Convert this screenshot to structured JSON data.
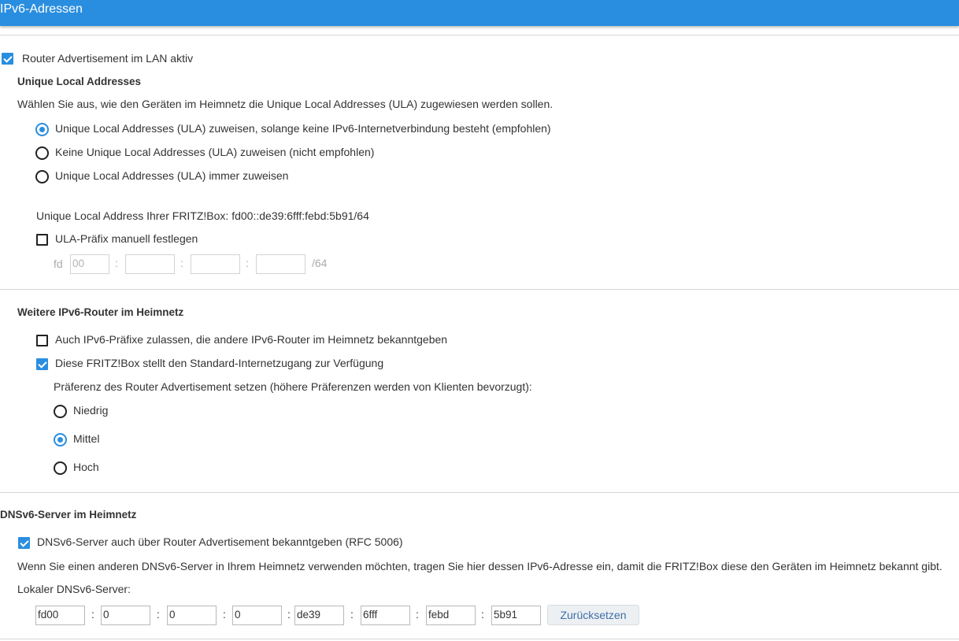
{
  "header": {
    "title": "IPv6-Adressen"
  },
  "router_adv": {
    "label": "Router Advertisement im LAN aktiv",
    "checked": true
  },
  "ula": {
    "heading": "Unique Local Addresses",
    "description": "Wählen Sie aus, wie den Geräten im Heimnetz die Unique Local Addresses (ULA) zugewiesen werden sollen.",
    "options": [
      {
        "label": "Unique Local Addresses (ULA) zuweisen, solange keine IPv6-Internetverbindung besteht (empfohlen)",
        "selected": true
      },
      {
        "label": "Keine Unique Local Addresses (ULA) zuweisen (nicht empfohlen)",
        "selected": false
      },
      {
        "label": "Unique Local Addresses (ULA) immer zuweisen",
        "selected": false
      }
    ],
    "address_text": "Unique Local Address Ihrer FRITZ!Box: fd00::de39:6fff:febd:5b91/64",
    "manual_label": "ULA-Präfix manuell festlegen",
    "manual_checked": false,
    "prefix_label": "fd",
    "prefix_fields": [
      "00",
      "",
      "",
      ""
    ],
    "separator": ":",
    "suffix": "/64"
  },
  "other_routers": {
    "heading": "Weitere IPv6-Router im Heimnetz",
    "allow_prefixes_label": "Auch IPv6-Präfixe zulassen, die andere IPv6-Router im Heimnetz bekanntgeben",
    "allow_prefixes_checked": false,
    "standard_gateway_label": "Diese FRITZ!Box stellt den Standard-Internetzugang zur Verfügung",
    "standard_gateway_checked": true,
    "preference_text": "Präferenz des Router Advertisement setzen (höhere Präferenzen werden von Klienten bevorzugt):",
    "preferences": [
      {
        "label": "Niedrig",
        "selected": false
      },
      {
        "label": "Mittel",
        "selected": true
      },
      {
        "label": "Hoch",
        "selected": false
      }
    ]
  },
  "dns": {
    "heading": "DNSv6-Server im Heimnetz",
    "announce_label": "DNSv6-Server auch über Router Advertisement bekanntgeben (RFC 5006)",
    "announce_checked": true,
    "description": "Wenn Sie einen anderen DNSv6-Server in Ihrem Heimnetz verwenden möchten, tragen Sie hier dessen IPv6-Adresse ein, damit die FRITZ!Box diese den Geräten im Heimnetz bekannt gibt.",
    "local_label": "Lokaler DNSv6-Server:",
    "fields": [
      "fd00",
      "0",
      "0",
      "0",
      "de39",
      "6fff",
      "febd",
      "5b91"
    ],
    "separator": ":",
    "reset_button": "Zurücksetzen"
  },
  "colors": {
    "accent": "#2a8ee0",
    "text": "#333333",
    "divider": "#d6d6d6"
  }
}
